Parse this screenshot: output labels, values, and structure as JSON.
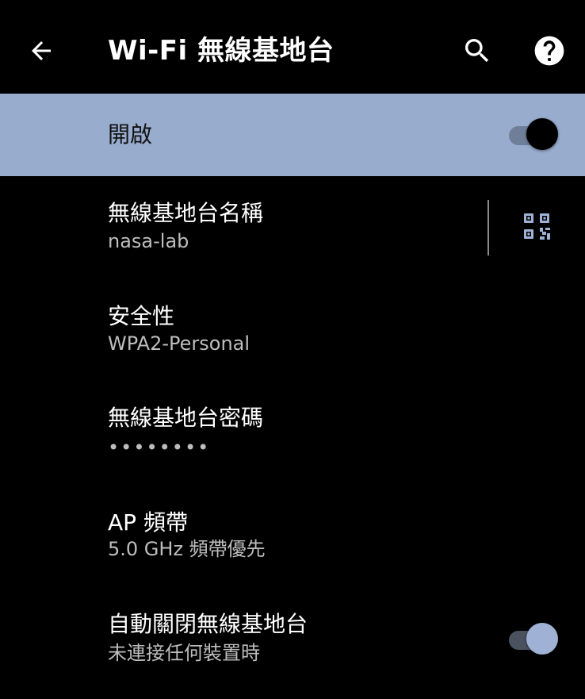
{
  "appbar": {
    "title": "Wi-Fi 無線基地台",
    "back_icon": "arrow-back-icon",
    "search_icon": "search-icon",
    "help_icon": "help-icon"
  },
  "main_switch": {
    "label": "開啟",
    "checked": true
  },
  "prefs": {
    "name": {
      "title": "無線基地台名稱",
      "summary": "nasa-lab",
      "action_icon": "qr-code-icon"
    },
    "security": {
      "title": "安全性",
      "summary": "WPA2-Personal"
    },
    "password": {
      "title": "無線基地台密碼",
      "summary": "••••••••"
    },
    "ap_band": {
      "title": "AP 頻帶",
      "summary": "5.0 GHz 頻帶優先"
    },
    "auto_off": {
      "title": "自動關閉無線基地台",
      "summary": "未連接任何裝置時",
      "checked": true
    }
  },
  "colors": {
    "background": "#000000",
    "highlight_bar": "#98acce",
    "accent": "#9fb2d6",
    "summary_text": "#bdbdbd"
  }
}
